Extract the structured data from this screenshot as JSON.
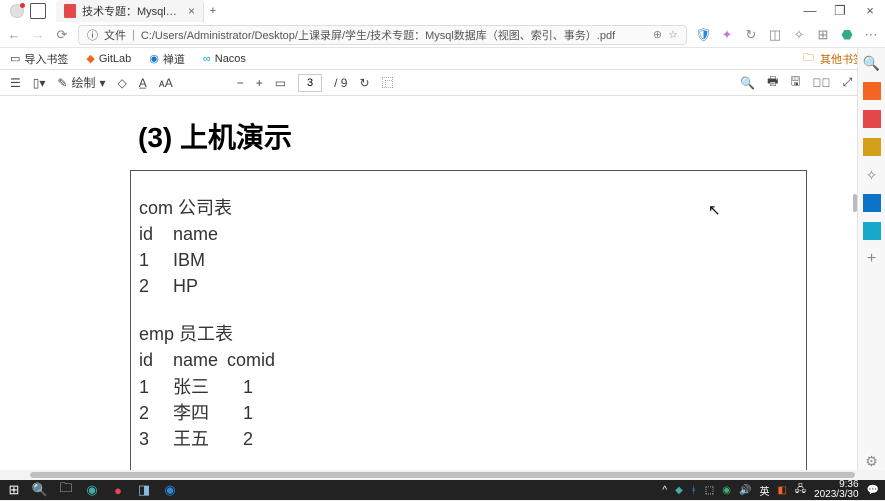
{
  "window": {
    "tab_title": "技术专题：Mysql数据库（视图...",
    "close": "×",
    "add": "+",
    "minimize": "—",
    "maximize": "❐"
  },
  "address": {
    "scheme_label": "文件",
    "path": "C:/Users/Administrator/Desktop/上课录屏/学生/技术专题：Mysql数据库（视图、索引、事务）.pdf"
  },
  "bookmarks": {
    "import": "导入书签",
    "gitlab": "GitLab",
    "chan": "禅道",
    "nacos": "Nacos",
    "other_folder": "其他书签夹"
  },
  "pdfbar": {
    "draw_label": "绘制",
    "current_page": "3",
    "total_pages": "/ 9",
    "zoom_minus": "−",
    "zoom_plus": "+",
    "page_icon": "▭",
    "rotate": "↻"
  },
  "pdf": {
    "heading": "(3)  上机演示",
    "table1_title": "com 公司表",
    "table1_header_id": "id",
    "table1_header_name": "name",
    "table1_r1_id": "1",
    "table1_r1_name": "IBM",
    "table1_r2_id": "2",
    "table1_r2_name": "HP",
    "table2_title": "emp 员工表",
    "table2_header_id": "id",
    "table2_header_name": "name",
    "table2_header_comid": "comid",
    "table2_r1_id": "1",
    "table2_r1_name": "张三",
    "table2_r1_comid": "1",
    "table2_r2_id": "2",
    "table2_r2_name": "李四",
    "table2_r2_comid": "1",
    "table2_r3_id": "3",
    "table2_r3_name": "王五",
    "table2_r3_comid": "2"
  },
  "taskbar": {
    "ime": "英",
    "time": "9:36",
    "date": "2023/3/30"
  }
}
